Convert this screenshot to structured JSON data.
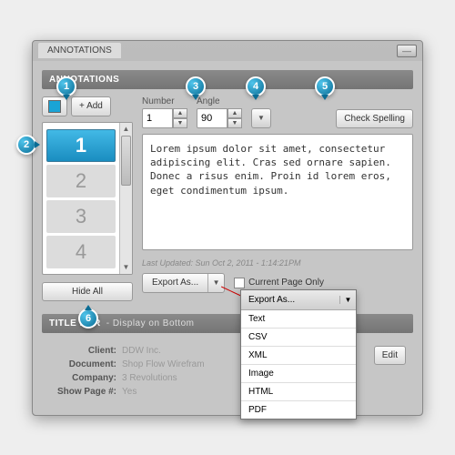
{
  "window": {
    "title": "ANNOTATIONS",
    "minimize_icon": "––"
  },
  "annotations": {
    "header": "ANNOTATIONS",
    "add_label": "+ Add",
    "items": [
      "1",
      "2",
      "3",
      "4"
    ],
    "hide_all_label": "Hide All",
    "number_label": "Number",
    "number_value": "1",
    "angle_label": "Angle",
    "angle_value": "90",
    "check_spelling_label": "Check Spelling",
    "text": "Lorem ipsum dolor sit amet, consectetur adipiscing elit. Cras sed ornare sapien. Donec a risus enim. Proin id lorem eros, eget condimentum ipsum.",
    "last_updated": "Last Updated: Sun Oct 2, 2011 - 1:14:21PM",
    "export_label": "Export As...",
    "current_page_only_label": "Current Page Only",
    "export_options": [
      "Text",
      "CSV",
      "XML",
      "Image",
      "HTML",
      "PDF"
    ]
  },
  "titlebar_section": {
    "header": "TITLE BAR",
    "subtitle": "- Display on Bottom",
    "client_k": "Client:",
    "client_v": "DDW Inc.",
    "document_k": "Document:",
    "document_v": "Shop Flow Wirefram",
    "company_k": "Company:",
    "company_v": "3 Revolutions",
    "showpage_k": "Show Page #:",
    "showpage_v": "Yes",
    "edit_label": "Edit"
  },
  "callouts": {
    "c1": "1",
    "c2": "2",
    "c3": "3",
    "c4": "4",
    "c5": "5",
    "c6": "6"
  }
}
